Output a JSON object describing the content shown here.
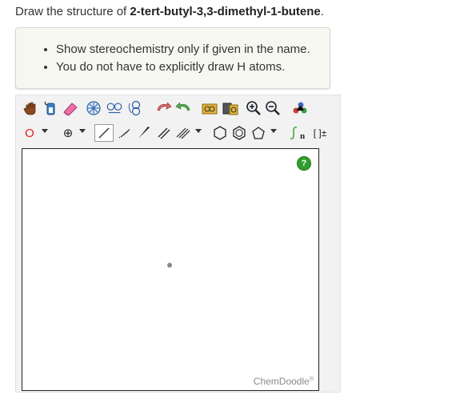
{
  "question": {
    "prefix": "Draw the structure of ",
    "compound": "2-tert-butyl-3,3-dimethyl-1-butene",
    "suffix": "."
  },
  "hints": [
    "Show stereochemistry only if given in the name.",
    "You do not have to explicitly draw H atoms."
  ],
  "toolbar": {
    "element_label": "O",
    "charge_label": "⊕",
    "sgroup_label": "n",
    "bracket_label": "[ ]±"
  },
  "canvas": {
    "help_label": "?",
    "brand_label": "ChemDoodle",
    "brand_mark": "®"
  }
}
